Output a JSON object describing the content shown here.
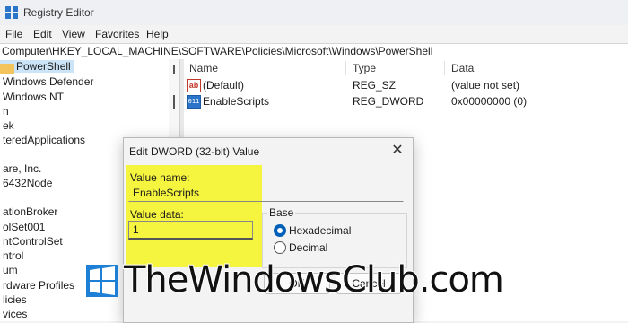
{
  "window": {
    "title": "Registry Editor"
  },
  "menu": [
    "File",
    "Edit",
    "View",
    "Favorites",
    "Help"
  ],
  "address": "Computer\\HKEY_LOCAL_MACHINE\\SOFTWARE\\Policies\\Microsoft\\Windows\\PowerShell",
  "tree": {
    "selected": "PowerShell",
    "items": [
      "Windows Defender",
      "Windows NT",
      "n",
      "ek",
      "teredApplications",
      "are, Inc.",
      "6432Node",
      "ationBroker",
      "olSet001",
      "ntControlSet",
      "ntrol",
      "um",
      "rdware Profiles",
      "licies",
      "vices"
    ]
  },
  "values": {
    "columns": [
      "Name",
      "Type",
      "Data"
    ],
    "rows": [
      {
        "icon": "string-value-icon",
        "icon_text": "ab",
        "name": "(Default)",
        "type": "REG_SZ",
        "data": "(value not set)"
      },
      {
        "icon": "binary-value-icon",
        "icon_text": "011",
        "name": "EnableScripts",
        "type": "REG_DWORD",
        "data": "0x00000000 (0)"
      }
    ]
  },
  "dialog": {
    "title": "Edit DWORD (32-bit) Value",
    "close": "✕",
    "value_name_label": "Value name:",
    "value_name": "EnableScripts",
    "value_data_label": "Value data:",
    "value_data": "1",
    "base_label": "Base",
    "radios": [
      {
        "label": "Hexadecimal",
        "checked": true
      },
      {
        "label": "Decimal",
        "checked": false
      }
    ],
    "ok": "OK",
    "cancel": "Cancel"
  },
  "watermark": "TheWindowsClub.com",
  "colors": {
    "highlight": "#f5f53f",
    "selection": "#cce4f7",
    "accent": "#005fb8"
  }
}
